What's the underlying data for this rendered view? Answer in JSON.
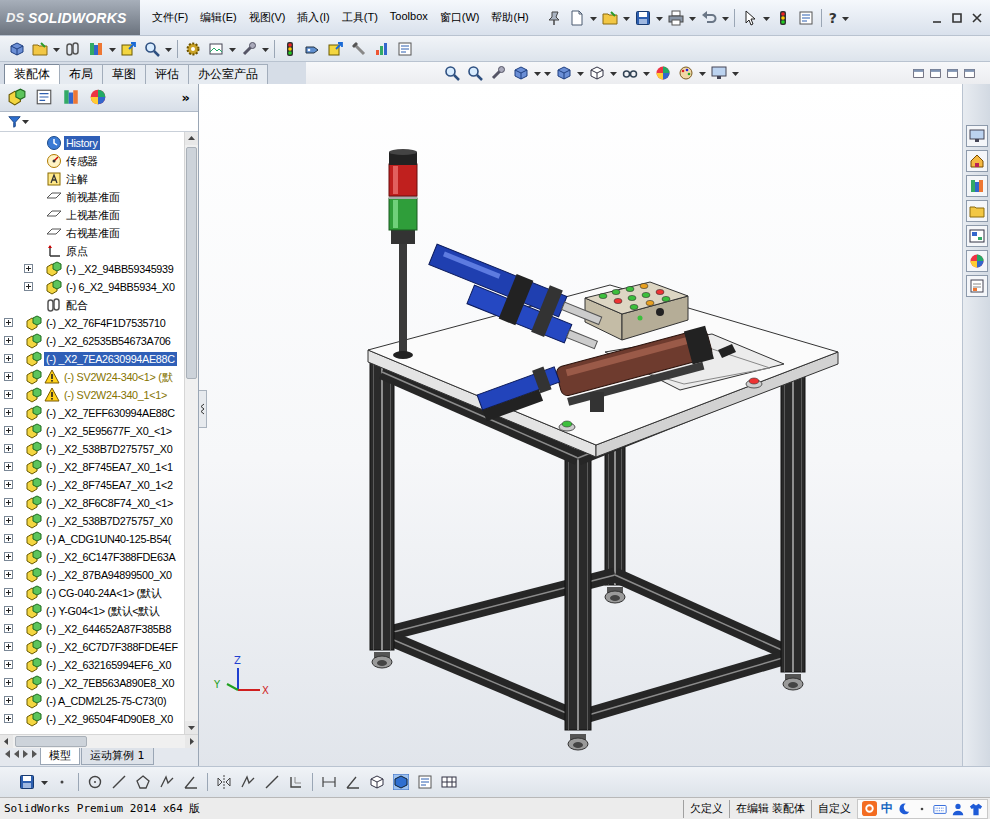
{
  "logo": {
    "brand": "DS",
    "name": "SOLIDWORKS"
  },
  "menu": [
    "文件(F)",
    "编辑(E)",
    "视图(V)",
    "插入(I)",
    "工具(T)",
    "Toolbox",
    "窗口(W)",
    "帮助(H)"
  ],
  "help_glyph": "?",
  "command_tabs": [
    {
      "label": "装配体",
      "selected": true
    },
    {
      "label": "布局",
      "selected": false
    },
    {
      "label": "草图",
      "selected": false
    },
    {
      "label": "评估",
      "selected": false
    },
    {
      "label": "办公室产品",
      "selected": false
    }
  ],
  "panel_more": "»",
  "tree": [
    {
      "label": "History",
      "kind": "history",
      "depth": 1,
      "expander": false,
      "warning": false,
      "selected": true
    },
    {
      "label": "传感器",
      "kind": "sensor",
      "depth": 1,
      "expander": false,
      "warning": false,
      "selected": false
    },
    {
      "label": "注解",
      "kind": "annotation",
      "depth": 1,
      "expander": false,
      "warning": false,
      "selected": false
    },
    {
      "label": "前视基准面",
      "kind": "plane",
      "depth": 1,
      "expander": false,
      "warning": false,
      "selected": false
    },
    {
      "label": "上视基准面",
      "kind": "plane",
      "depth": 1,
      "expander": false,
      "warning": false,
      "selected": false
    },
    {
      "label": "右视基准面",
      "kind": "plane",
      "depth": 1,
      "expander": false,
      "warning": false,
      "selected": false
    },
    {
      "label": "原点",
      "kind": "origin",
      "depth": 1,
      "expander": false,
      "warning": false,
      "selected": false
    },
    {
      "label": "(-) _X2_94BB59345939",
      "kind": "subassembly",
      "depth": 1,
      "expander": true,
      "warning": false,
      "selected": false
    },
    {
      "label": "(-) 6_X2_94BB5934_X0",
      "kind": "subassembly",
      "depth": 1,
      "expander": true,
      "warning": false,
      "selected": false
    },
    {
      "label": "配合",
      "kind": "mates",
      "depth": 1,
      "expander": false,
      "warning": false,
      "selected": false
    },
    {
      "label": "(-) _X2_76F4F1D7535710",
      "kind": "subassembly",
      "depth": 0,
      "expander": true,
      "warning": false,
      "selected": false
    },
    {
      "label": "(-) _X2_62535B54673A706",
      "kind": "subassembly",
      "depth": 0,
      "expander": true,
      "warning": false,
      "selected": false
    },
    {
      "label": "(-) _X2_7EA2630994AE88C",
      "kind": "subassembly",
      "depth": 0,
      "expander": true,
      "warning": false,
      "selected": true
    },
    {
      "label": "(-) SV2W24-340<1> (默",
      "kind": "subassembly",
      "depth": 0,
      "expander": true,
      "warning": true,
      "selected": false
    },
    {
      "label": "(-) SV2W24-340_1<1>",
      "kind": "subassembly",
      "depth": 0,
      "expander": true,
      "warning": true,
      "selected": false
    },
    {
      "label": "(-) _X2_7EFF630994AE88C",
      "kind": "subassembly",
      "depth": 0,
      "expander": true,
      "warning": false,
      "selected": false
    },
    {
      "label": "(-) _X2_5E95677F_X0_<1>",
      "kind": "subassembly",
      "depth": 0,
      "expander": true,
      "warning": false,
      "selected": false
    },
    {
      "label": "(-) _X2_538B7D275757_X0",
      "kind": "subassembly",
      "depth": 0,
      "expander": true,
      "warning": false,
      "selected": false
    },
    {
      "label": "(-) _X2_8F745EA7_X0_1<1",
      "kind": "subassembly",
      "depth": 0,
      "expander": true,
      "warning": false,
      "selected": false
    },
    {
      "label": "(-) _X2_8F745EA7_X0_1<2",
      "kind": "subassembly",
      "depth": 0,
      "expander": true,
      "warning": false,
      "selected": false
    },
    {
      "label": "(-) _X2_8F6C8F74_X0_<1>",
      "kind": "subassembly",
      "depth": 0,
      "expander": true,
      "warning": false,
      "selected": false
    },
    {
      "label": "(-) _X2_538B7D275757_X0",
      "kind": "subassembly",
      "depth": 0,
      "expander": true,
      "warning": false,
      "selected": false
    },
    {
      "label": "(-) A_CDG1UN40-125-B54(",
      "kind": "subassembly",
      "depth": 0,
      "expander": true,
      "warning": false,
      "selected": false
    },
    {
      "label": "(-) _X2_6C147F388FDE63A",
      "kind": "subassembly",
      "depth": 0,
      "expander": true,
      "warning": false,
      "selected": false
    },
    {
      "label": "(-) _X2_87BA94899500_X0",
      "kind": "subassembly",
      "depth": 0,
      "expander": true,
      "warning": false,
      "selected": false
    },
    {
      "label": "(-) CG-040-24A<1> (默认",
      "kind": "subassembly",
      "depth": 0,
      "expander": true,
      "warning": false,
      "selected": false
    },
    {
      "label": "(-) Y-G04<1> (默认<默认",
      "kind": "subassembly",
      "depth": 0,
      "expander": true,
      "warning": false,
      "selected": false
    },
    {
      "label": "(-) _X2_644652A87F385B8",
      "kind": "subassembly",
      "depth": 0,
      "expander": true,
      "warning": false,
      "selected": false
    },
    {
      "label": "(-) _X2_6C7D7F388FDE4EF",
      "kind": "subassembly",
      "depth": 0,
      "expander": true,
      "warning": false,
      "selected": false
    },
    {
      "label": "(-) _X2_632165994EF6_X0",
      "kind": "subassembly",
      "depth": 0,
      "expander": true,
      "warning": false,
      "selected": false
    },
    {
      "label": "(-) _X2_7EB563A890E8_X0",
      "kind": "subassembly",
      "depth": 0,
      "expander": true,
      "warning": false,
      "selected": false
    },
    {
      "label": "(-) A_CDM2L25-75-C73(0)",
      "kind": "subassembly",
      "depth": 0,
      "expander": true,
      "warning": false,
      "selected": false
    },
    {
      "label": "(-) _X2_96504F4D90E8_X0",
      "kind": "subassembly",
      "depth": 0,
      "expander": true,
      "warning": false,
      "selected": false
    }
  ],
  "bottom_tabs": [
    {
      "label": "模型",
      "selected": true
    },
    {
      "label": "运动算例 1",
      "selected": false
    }
  ],
  "triad": {
    "z": "Z",
    "x": "X",
    "y": "Y"
  },
  "status_bar": {
    "product": "SolidWorks Premium 2014 x64 版",
    "state": "欠定义",
    "mode": "在编辑 装配体",
    "custom": "自定义"
  },
  "ime": {
    "lang": "中"
  }
}
